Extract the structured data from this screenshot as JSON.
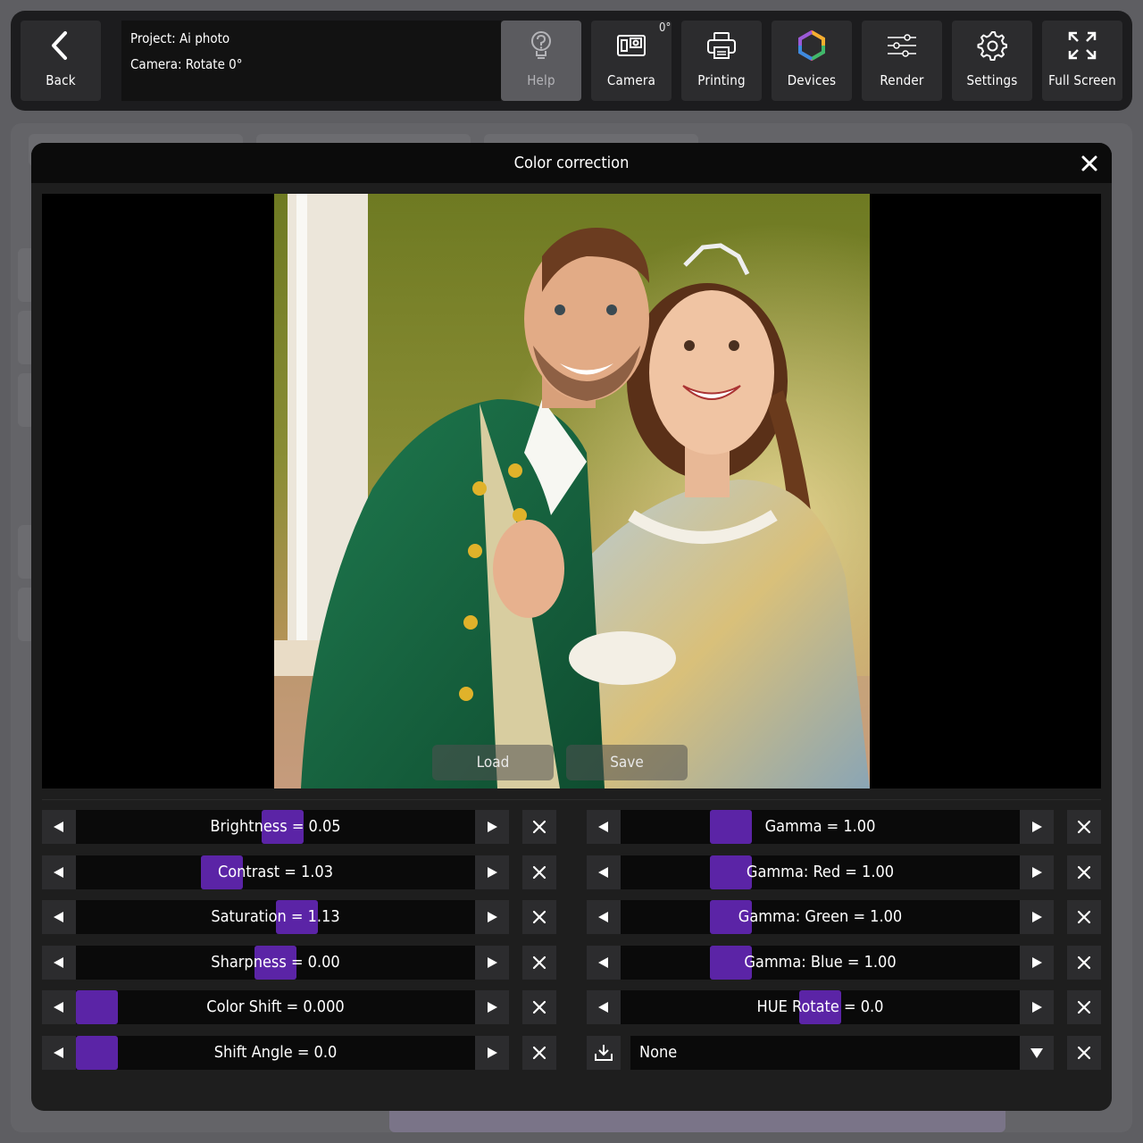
{
  "toolbar": {
    "back_label": "Back",
    "project_line": "Project: Ai photo",
    "camera_line": "Camera: Rotate 0°",
    "camera_rotation_badge": "0°",
    "buttons": [
      {
        "label": "Help",
        "icon": "help-bulb-icon",
        "disabled": true
      },
      {
        "label": "Camera",
        "icon": "camera-icon"
      },
      {
        "label": "Printing",
        "icon": "printer-icon"
      },
      {
        "label": "Devices",
        "icon": "devices-hexagon-icon"
      },
      {
        "label": "Render",
        "icon": "sliders-icon"
      },
      {
        "label": "Settings",
        "icon": "gear-icon"
      },
      {
        "label": "Full Screen",
        "icon": "fullscreen-icon"
      }
    ]
  },
  "dialog": {
    "title": "Color correction",
    "close_icon": "close-icon",
    "preview": {
      "load_label": "Load",
      "save_label": "Save"
    }
  },
  "sliders_left": [
    {
      "label": "Brightness = 0.05",
      "level": 0.52
    },
    {
      "label": "Contrast = 1.03",
      "level": 0.35
    },
    {
      "label": "Saturation = 1.13",
      "level": 0.56
    },
    {
      "label": "Sharpness = 0.00",
      "level": 0.5
    },
    {
      "label": "Color Shift = 0.000",
      "level": 0.0
    },
    {
      "label": "Shift Angle = 0.0",
      "level": 0.0
    }
  ],
  "sliders_right": [
    {
      "label": "Gamma = 1.00",
      "level": 0.25
    },
    {
      "label": "Gamma: Red = 1.00",
      "level": 0.25
    },
    {
      "label": "Gamma: Green = 1.00",
      "level": 0.25
    },
    {
      "label": "Gamma: Blue = 1.00",
      "level": 0.25
    },
    {
      "label": "HUE Rotate = 0.0",
      "level": 0.5
    }
  ],
  "preset_select": {
    "value": "None",
    "icon": "download-icon"
  },
  "colors": {
    "accent": "#5b24a6",
    "toolbar_bg": "#1c1c1e",
    "dialog_bg": "#1e1e1e"
  }
}
